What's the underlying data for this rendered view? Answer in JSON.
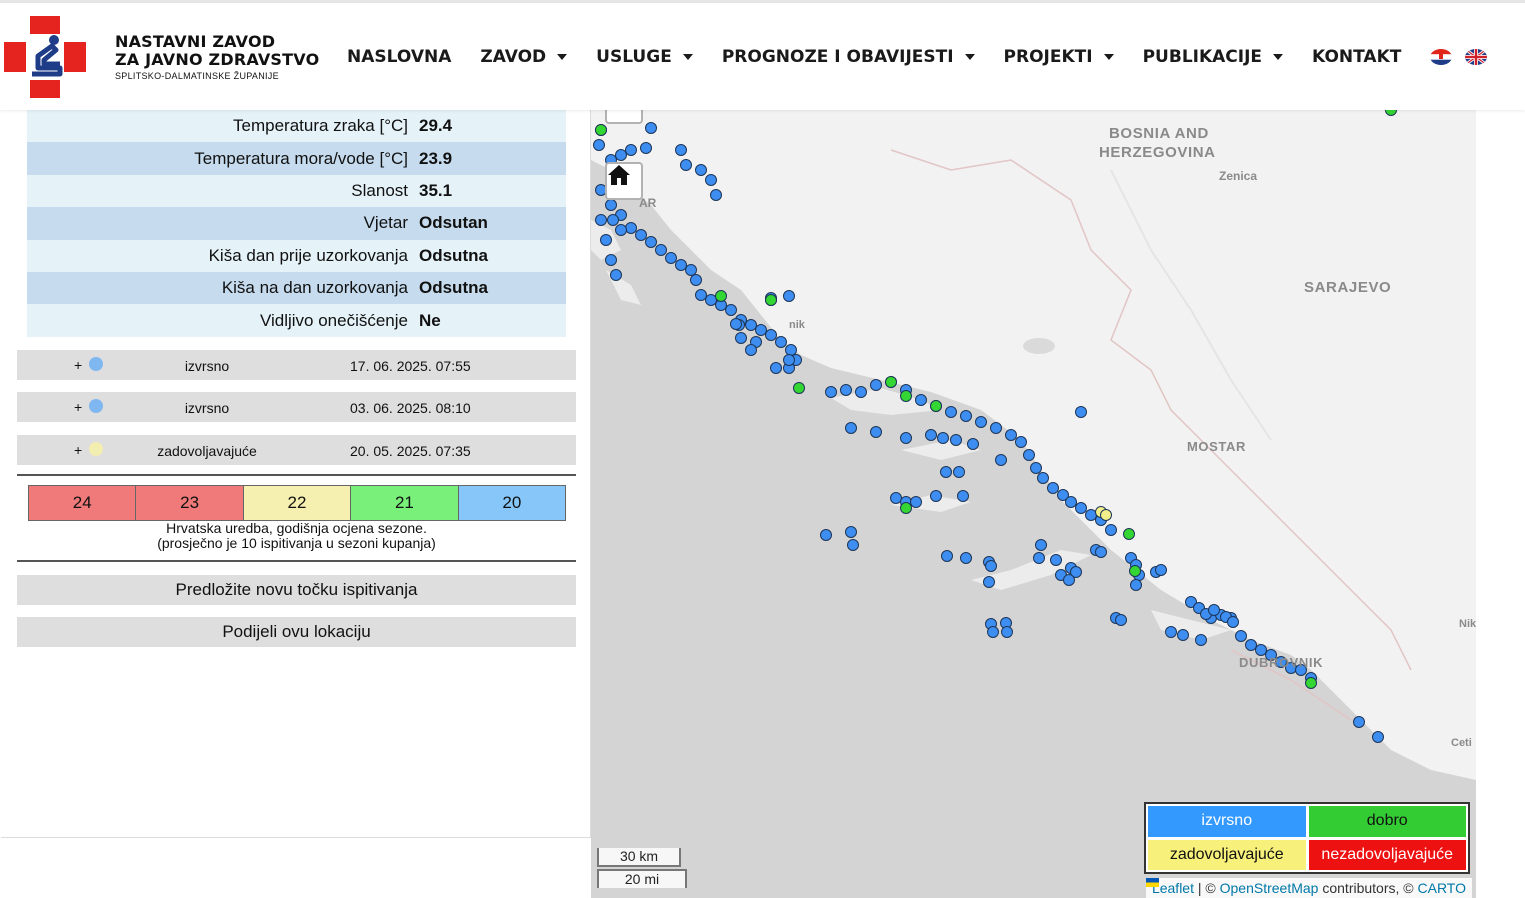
{
  "header": {
    "logo": {
      "line1": "NASTAVNI ZAVOD",
      "line2": "ZA JAVNO ZDRAVSTVO",
      "line3": "SPLITSKO-DALMATINSKE ŽUPANIJE"
    },
    "nav": {
      "home": "NASLOVNA",
      "institute": "ZAVOD",
      "services": "USLUGE",
      "forecasts": "PROGNOZE I OBAVIJESTI",
      "projects": "PROJEKTI",
      "publications": "PUBLIKACIJE",
      "contact": "KONTAKT"
    },
    "languages": [
      "hr",
      "en"
    ]
  },
  "params": [
    {
      "label": "Temperatura zraka [°C]",
      "value": "29.4"
    },
    {
      "label": "Temperatura mora/vode [°C]",
      "value": "23.9"
    },
    {
      "label": "Slanost",
      "value": "35.1"
    },
    {
      "label": "Vjetar",
      "value": "Odsutan"
    },
    {
      "label": "Kiša dan prije uzorkovanja",
      "value": "Odsutna"
    },
    {
      "label": "Kiša na dan uzorkovanja",
      "value": "Odsutna"
    },
    {
      "label": "Vidljivo onečišćenje",
      "value": "Ne"
    }
  ],
  "samples": [
    {
      "plus": "+",
      "rating": "izvrsno",
      "date": "17. 06. 2025. 07:55",
      "color": "#7fb8f0"
    },
    {
      "plus": "+",
      "rating": "izvrsno",
      "date": "03. 06. 2025. 08:10",
      "color": "#7fb8f0"
    },
    {
      "plus": "+",
      "rating": "zadovoljavajuće",
      "date": "20. 05. 2025. 07:35",
      "color": "#f2eeb0"
    }
  ],
  "season_scale": [
    {
      "value": "24",
      "color": "#f07a7a"
    },
    {
      "value": "23",
      "color": "#f07a7a"
    },
    {
      "value": "22",
      "color": "#f5f0b0"
    },
    {
      "value": "21",
      "color": "#79f07a"
    },
    {
      "value": "20",
      "color": "#86c6f8"
    }
  ],
  "season_note": {
    "line1": "Hrvatska uredba, godišnja ocjena sezone.",
    "line2": "(prosječno je 10 ispitivanja u sezoni kupanja)"
  },
  "actions": {
    "suggest": "Predložite novu točku ispitivanja",
    "share": "Podijeli ovu lokaciju"
  },
  "map": {
    "labels": {
      "bosnia1": "BOSNIA AND",
      "bosnia2": "HERZEGOVINA",
      "zenica": "Zenica",
      "sarajevo": "SARAJEVO",
      "mostar": "MOSTAR",
      "dubrovnik": "DUBROVNIK",
      "cetinje": "Ceti",
      "niksic": "Nik",
      "zadar": "AR",
      "sibenik": "nik"
    },
    "legend": [
      {
        "label": "izvrsno",
        "color": "#3399ff",
        "text_color": "#ffffff"
      },
      {
        "label": "dobro",
        "color": "#33cc33",
        "text_color": "#111111"
      },
      {
        "label": "zadovoljavajuće",
        "color": "#f7f07a",
        "text_color": "#111111"
      },
      {
        "label": "nezadovoljavajuće",
        "color": "#ee1111",
        "text_color": "#ffffff"
      }
    ],
    "scale_km": "30 km",
    "scale_mi": "20 mi",
    "attribution": {
      "leaflet": "Leaflet",
      "sep1": " | © ",
      "osm": "OpenStreetMap",
      "sep2": " contributors, © ",
      "carto": "CARTO"
    },
    "marker_colors": {
      "blue": "#3d8ef0",
      "green": "#33d633",
      "yellow": "#f2ee8a"
    }
  }
}
